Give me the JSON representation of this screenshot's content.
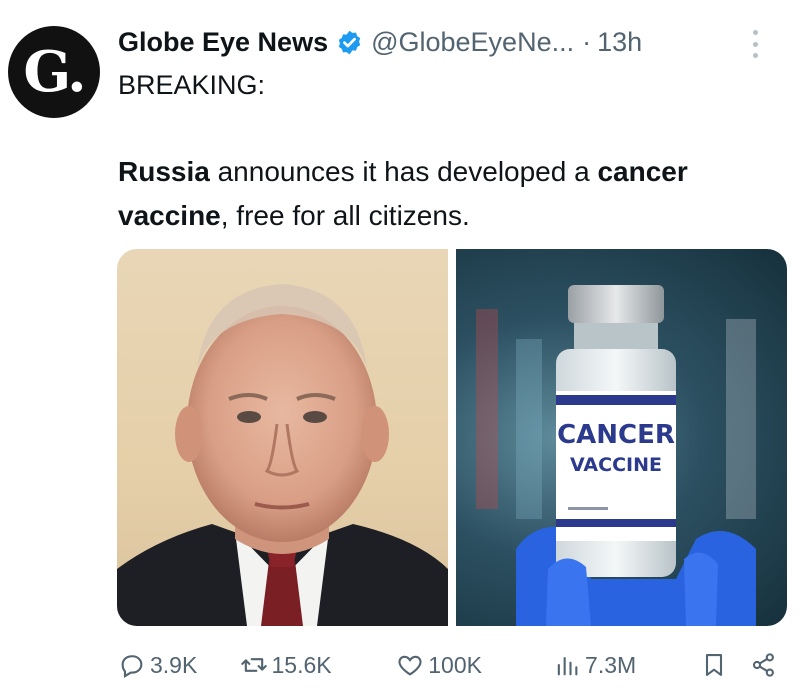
{
  "account": {
    "logo_text": "G.",
    "name": "Globe Eye News",
    "handle": "@GlobeEyeNe...",
    "separator": "·",
    "time": "13h"
  },
  "post": {
    "heading": "BREAKING:",
    "text_parts": [
      {
        "text": "Russia",
        "bold": true
      },
      {
        "text": " announces it has developed a ",
        "bold": false
      },
      {
        "text": "cancer vaccine",
        "bold": true
      },
      {
        "text": ", free for all citizens.",
        "bold": false
      }
    ],
    "vial_label_line1": "CANCER",
    "vial_label_line2": "VACCINE"
  },
  "actions": {
    "replies": "3.9K",
    "reposts": "15.6K",
    "likes": "100K",
    "views": "7.3M"
  },
  "colors": {
    "text": "#0f1419",
    "muted": "#536471",
    "verified": "#1d9bf0",
    "vial_band": "#2b3a8c"
  }
}
